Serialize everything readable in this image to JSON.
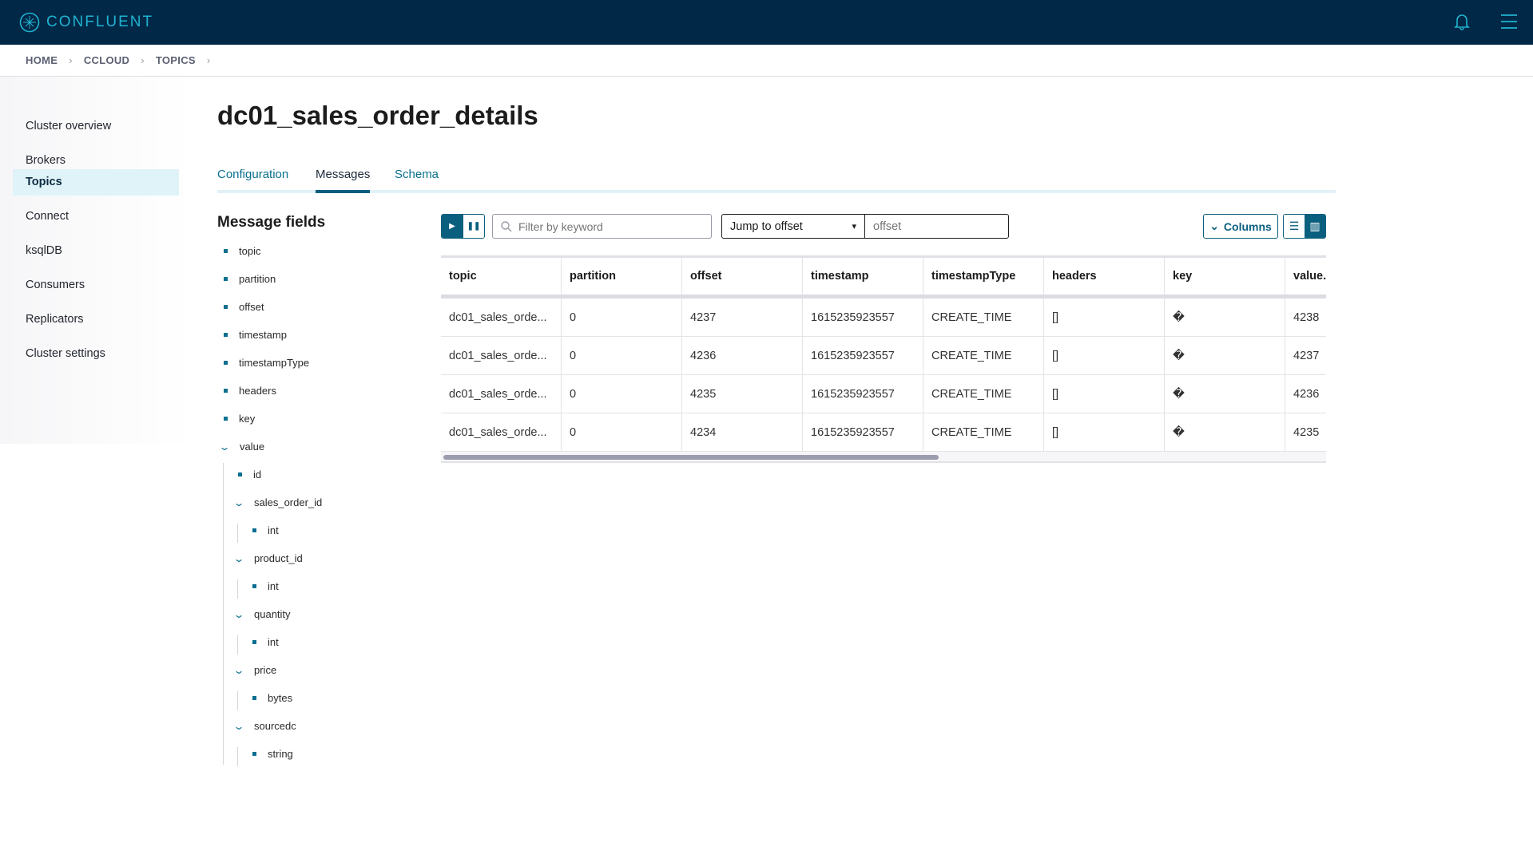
{
  "app": {
    "brand": "CONFLUENT"
  },
  "breadcrumb": [
    "HOME",
    "CCLOUD",
    "TOPICS"
  ],
  "sidebar": {
    "items": [
      {
        "label": "Cluster overview"
      },
      {
        "label": "Brokers"
      },
      {
        "label": "Topics",
        "active": true
      },
      {
        "label": "Connect"
      },
      {
        "label": "ksqlDB"
      },
      {
        "label": "Consumers"
      },
      {
        "label": "Replicators"
      },
      {
        "label": "Cluster settings"
      }
    ]
  },
  "page": {
    "title": "dc01_sales_order_details"
  },
  "tabs": [
    {
      "label": "Configuration"
    },
    {
      "label": "Messages",
      "active": true
    },
    {
      "label": "Schema"
    }
  ],
  "message_fields": {
    "title": "Message fields",
    "items": [
      "topic",
      "partition",
      "offset",
      "timestamp",
      "timestampType",
      "headers",
      "key",
      "value",
      "id",
      "sales_order_id",
      "int",
      "product_id",
      "int",
      "quantity",
      "int",
      "price",
      "bytes",
      "sourcedc",
      "string"
    ]
  },
  "toolbar": {
    "filter_placeholder": "Filter by keyword",
    "jump_label": "Jump to offset",
    "offset_placeholder": "offset",
    "columns_label": "Columns"
  },
  "table": {
    "columns": [
      "topic",
      "partition",
      "offset",
      "timestamp",
      "timestampType",
      "headers",
      "key",
      "value."
    ],
    "rows": [
      [
        "dc01_sales_orde...",
        "0",
        "4237",
        "1615235923557",
        "CREATE_TIME",
        "[]",
        "�",
        "4238"
      ],
      [
        "dc01_sales_orde...",
        "0",
        "4236",
        "1615235923557",
        "CREATE_TIME",
        "[]",
        "�",
        "4237"
      ],
      [
        "dc01_sales_orde...",
        "0",
        "4235",
        "1615235923557",
        "CREATE_TIME",
        "[]",
        "�",
        "4236"
      ],
      [
        "dc01_sales_orde...",
        "0",
        "4234",
        "1615235923557",
        "CREATE_TIME",
        "[]",
        "�",
        "4235"
      ]
    ]
  },
  "colors": {
    "header_bg": "#022847",
    "accent": "#0b5f7e",
    "brand": "#1fb3d1"
  }
}
